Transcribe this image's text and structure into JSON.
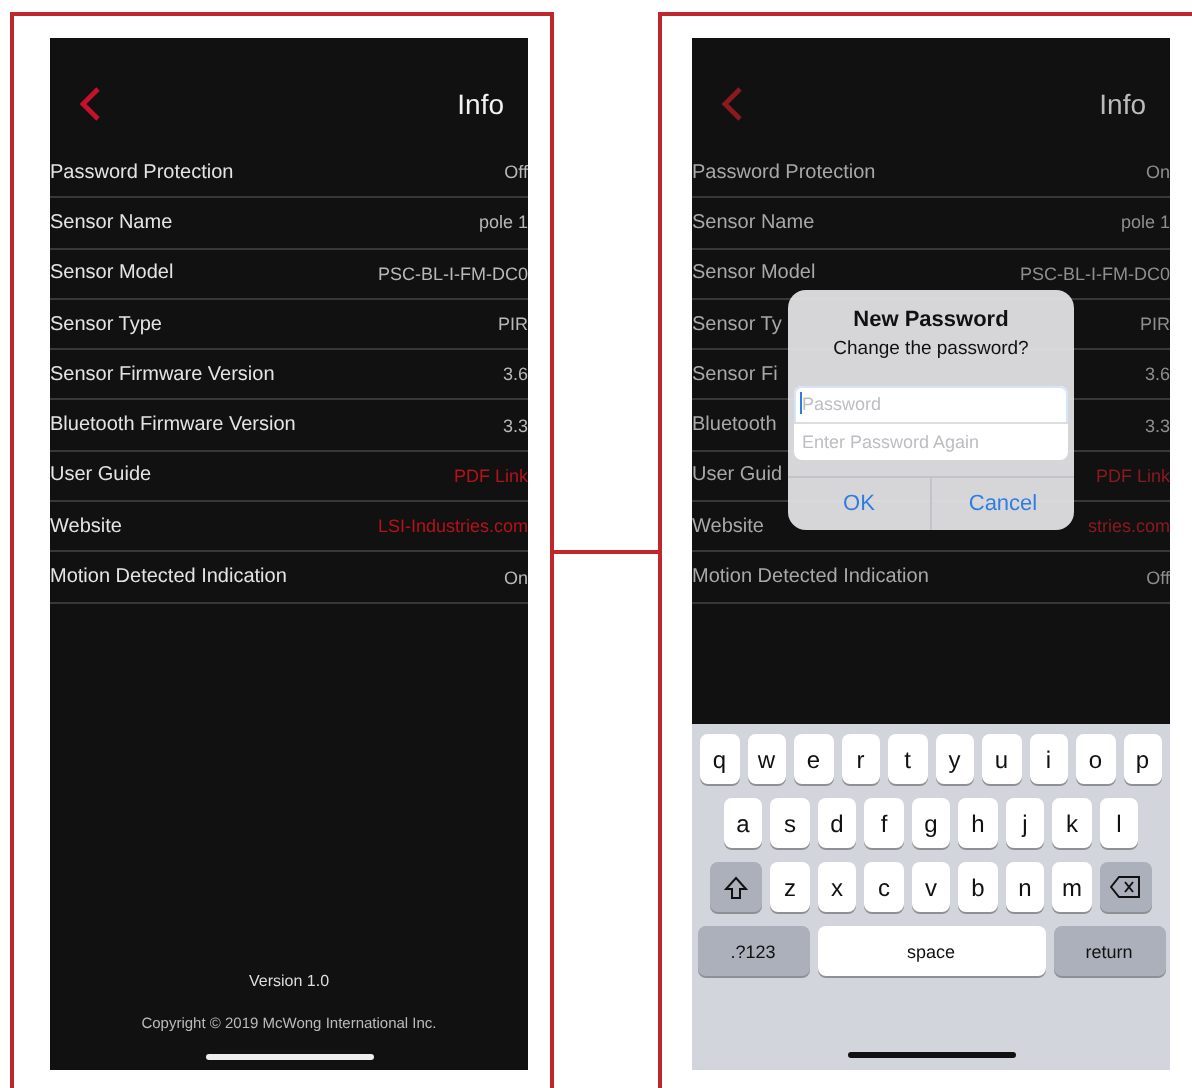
{
  "screens": [
    {
      "title": "Info",
      "rows": [
        {
          "label": "Password Protection",
          "value": "Off",
          "kind": "text"
        },
        {
          "label": "Sensor Name",
          "value": "pole 1",
          "kind": "text"
        },
        {
          "label": "Sensor Model",
          "value": "PSC-BL-I-FM-DC0",
          "kind": "text"
        },
        {
          "label": "Sensor Type",
          "value": "PIR",
          "kind": "text"
        },
        {
          "label": "Sensor Firmware Version",
          "value": "3.6",
          "kind": "text"
        },
        {
          "label": "Bluetooth Firmware Version",
          "value": "3.3",
          "kind": "text"
        },
        {
          "label": "User Guide",
          "value": "PDF Link",
          "kind": "link"
        },
        {
          "label": "Website",
          "value": "LSI-Industries.com",
          "kind": "link"
        },
        {
          "label": "Motion Detected Indication",
          "value": "On",
          "kind": "text"
        }
      ],
      "footer": {
        "version": "Version 1.0",
        "copyright": "Copyright © 2019 McWong International Inc."
      }
    },
    {
      "title": "Info",
      "rows": [
        {
          "label": "Password Protection",
          "value": "On",
          "kind": "text"
        },
        {
          "label": "Sensor Name",
          "value": "pole 1",
          "kind": "text"
        },
        {
          "label": "Sensor Model",
          "value": "PSC-BL-I-FM-DC0",
          "kind": "text"
        },
        {
          "label": "Sensor Ty",
          "value": "PIR",
          "kind": "text"
        },
        {
          "label": "Sensor Fi",
          "value": "3.6",
          "kind": "text"
        },
        {
          "label": "Bluetooth",
          "value": "3.3",
          "kind": "text"
        },
        {
          "label": "User Guid",
          "value": "PDF Link",
          "kind": "link"
        },
        {
          "label": "Website",
          "value": "stries.com",
          "kind": "link"
        },
        {
          "label": "Motion Detected Indication",
          "value": "Off",
          "kind": "text"
        }
      ],
      "dialog": {
        "title": "New Password",
        "message": "Change the password?",
        "fields": [
          {
            "placeholder": "Password",
            "focused": true
          },
          {
            "placeholder": "Enter Password Again",
            "focused": false
          }
        ],
        "buttons": [
          "OK",
          "Cancel"
        ]
      },
      "keyboard": {
        "rows": [
          {
            "keys": [
              {
                "kind": "letter",
                "label": "q"
              },
              {
                "kind": "letter",
                "label": "w"
              },
              {
                "kind": "letter",
                "label": "e"
              },
              {
                "kind": "letter",
                "label": "r"
              },
              {
                "kind": "letter",
                "label": "t"
              },
              {
                "kind": "letter",
                "label": "y"
              },
              {
                "kind": "letter",
                "label": "u"
              },
              {
                "kind": "letter",
                "label": "i"
              },
              {
                "kind": "letter",
                "label": "o"
              },
              {
                "kind": "letter",
                "label": "p"
              }
            ]
          },
          {
            "keys": [
              {
                "kind": "letter",
                "label": "a"
              },
              {
                "kind": "letter",
                "label": "s"
              },
              {
                "kind": "letter",
                "label": "d"
              },
              {
                "kind": "letter",
                "label": "f"
              },
              {
                "kind": "letter",
                "label": "g"
              },
              {
                "kind": "letter",
                "label": "h"
              },
              {
                "kind": "letter",
                "label": "j"
              },
              {
                "kind": "letter",
                "label": "k"
              },
              {
                "kind": "letter",
                "label": "l"
              }
            ]
          },
          {
            "keys": [
              {
                "kind": "shift"
              },
              {
                "kind": "letter",
                "label": "z"
              },
              {
                "kind": "letter",
                "label": "x"
              },
              {
                "kind": "letter",
                "label": "c"
              },
              {
                "kind": "letter",
                "label": "v"
              },
              {
                "kind": "letter",
                "label": "b"
              },
              {
                "kind": "letter",
                "label": "n"
              },
              {
                "kind": "letter",
                "label": "m"
              },
              {
                "kind": "delete"
              }
            ]
          },
          {
            "keys": [
              {
                "kind": "mode",
                "label": ".?123"
              },
              {
                "kind": "space",
                "label": "space"
              },
              {
                "kind": "return",
                "label": "return"
              }
            ]
          }
        ]
      }
    }
  ]
}
